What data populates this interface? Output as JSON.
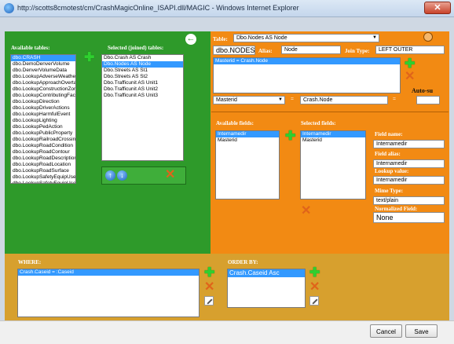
{
  "window": {
    "title": "http://scotts8cmotest/cm/CrashMagicOnline_ISAPI.dll/MAGIC - Windows Internet Explorer",
    "close_label": "✕"
  },
  "tables_panel": {
    "available_label": "Available tables:",
    "available_tables": [
      "dbo.CRASH",
      "dbo.DemoDenverVolume",
      "dbo.DenverVolumeData",
      "dbo.LookupAdverseWeathe",
      "dbo.LookupApproachOverta",
      "dbo.LookupConstructionZon",
      "dbo.LookupContributingFact",
      "dbo.LookupDirection",
      "dbo.LookupDriverActions",
      "dbo.LookupHarmfulEvent",
      "dbo.LookupLighting",
      "dbo.LookupPedAction",
      "dbo.LookupPublicProperty",
      "dbo.LookupRailroadCrossing",
      "dbo.LookupRoadCondition",
      "dbo.LookupRoadContour",
      "dbo.LookupRoadDescription",
      "dbo.LookupRoadLocation",
      "dbo.LookupRoadSurface",
      "dbo.LookupSafetyEquipUse",
      "dbo.LookupSafetyEquipUse"
    ],
    "available_selected_index": 0,
    "selected_label": "Selected (joined) tables:",
    "selected_tables": [
      "Dbo.Crash AS Crash",
      "Dbo.Nodes AS Node",
      "Dbo.Streets AS St1",
      "Dbo.Streets AS St2",
      "Dbo.Trafficunit AS Unit1",
      "Dbo.Trafficunit AS Unit2",
      "Dbo.Trafficunit AS Unit3"
    ],
    "selected_selected_index": 1
  },
  "join_panel": {
    "table_label": "Table:",
    "table_value": "Dbo.Nodes AS Node",
    "table_name": "dbo.NODES",
    "alias_label": "Alias:",
    "alias_value": "Node",
    "join_type_label": "Join Type:",
    "join_type_value": "LEFT OUTER",
    "join_conditions": [
      "Masterid = Crash.Node"
    ],
    "auto_label": "Auto-su",
    "left_field": "Masterid",
    "operator": "=",
    "right_field": "Crash.Node"
  },
  "fields_panel": {
    "available_label": "Available fields:",
    "available_fields": [
      "Internamedir",
      "Masterid"
    ],
    "selected_label": "Selected fields:",
    "selected_fields": [
      "Internamedir",
      "Masterid"
    ],
    "field_name_label": "Field name:",
    "field_name_value": "Internamedir",
    "field_alias_label": "Field alias:",
    "field_alias_value": "Internamedir",
    "lookup_label": "Lookup value:",
    "lookup_value": "Internamedir",
    "mime_label": "Mime Type:",
    "mime_value": "text/plain",
    "normalized_label": "Normalized Field:",
    "normalized_value": "None"
  },
  "where_panel": {
    "label": "WHERE:",
    "conditions": [
      "Crash.Caseid = :Caseid"
    ]
  },
  "order_panel": {
    "label": "ORDER BY:",
    "items": [
      "Crash.Caseid Asc"
    ]
  },
  "footer": {
    "cancel_label": "Cancel",
    "save_label": "Save"
  },
  "colors": {
    "green_panel": "#2e9a2a",
    "orange_panel": "#f28a13",
    "tan_panel": "#d7a02e",
    "selection": "#3399ff"
  }
}
